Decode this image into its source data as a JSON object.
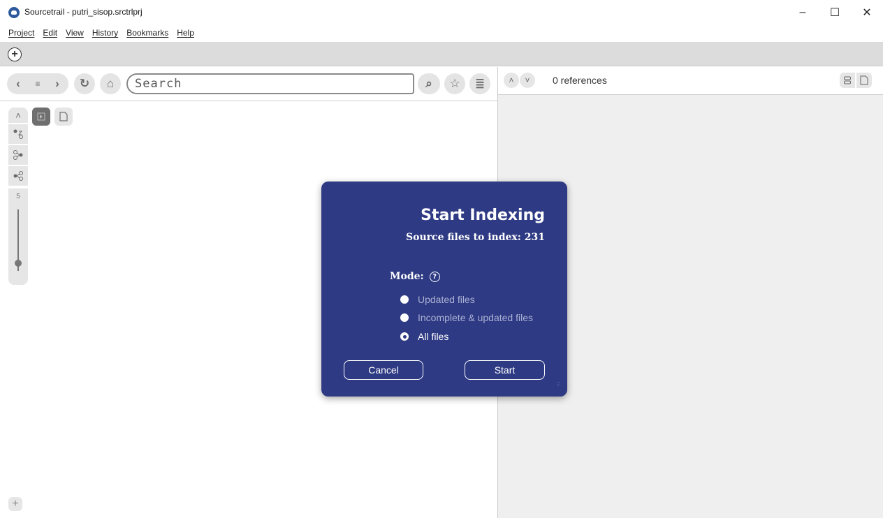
{
  "window": {
    "title": "Sourcetrail - putri_sisop.srctrlprj",
    "minimize_glyph": "–",
    "maximize_glyph": "☐",
    "close_glyph": "✕"
  },
  "menu": {
    "items": [
      "Project",
      "Edit",
      "View",
      "History",
      "Bookmarks",
      "Help"
    ]
  },
  "tabs": {
    "add_glyph": "+"
  },
  "toolbar": {
    "back_glyph": "‹",
    "history_glyph": "≡",
    "forward_glyph": "›",
    "refresh_glyph": "↻",
    "home_glyph": "⌂",
    "search_placeholder": "Search",
    "search_glyph": "⌕",
    "bookmark_glyph": "☆",
    "bookmarks_list_glyph": "≣"
  },
  "graph_controls": {
    "depth_value": "5",
    "up_glyph": "˄",
    "zoom_in_glyph": "+"
  },
  "references": {
    "count_text": "0 references",
    "prev_glyph": "˄",
    "next_glyph": "˅"
  },
  "dialog": {
    "title": "Start Indexing",
    "subtitle": "Source files to index: 231",
    "mode_label": "Mode:",
    "help_glyph": "?",
    "options": [
      {
        "label": "Updated files",
        "selected": false
      },
      {
        "label": "Incomplete & updated files",
        "selected": false
      },
      {
        "label": "All files",
        "selected": true
      }
    ],
    "cancel_label": "Cancel",
    "start_label": "Start",
    "background_color": "#2e3a83"
  }
}
